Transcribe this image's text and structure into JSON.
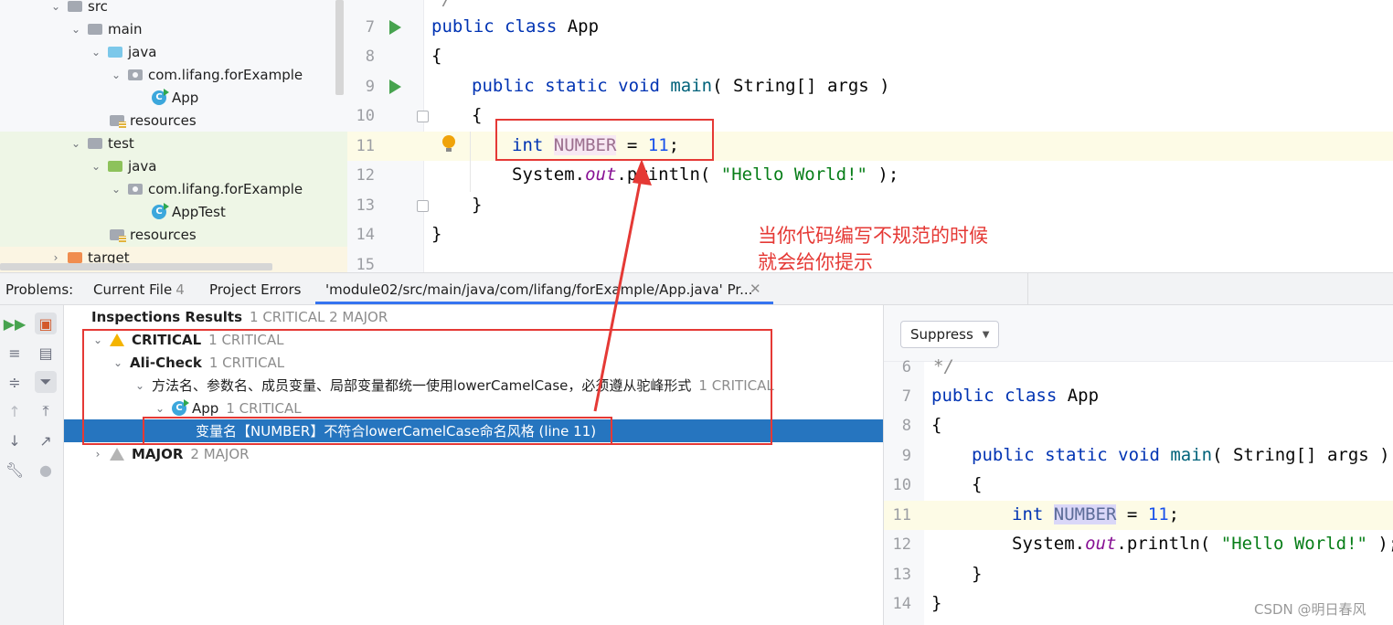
{
  "project_tree": {
    "items": [
      {
        "label": "src"
      },
      {
        "label": "main"
      },
      {
        "label": "java"
      },
      {
        "label": "com.lifang.forExample"
      },
      {
        "label": "App"
      },
      {
        "label": "resources"
      },
      {
        "label": "test"
      },
      {
        "label": "java"
      },
      {
        "label": "com.lifang.forExample"
      },
      {
        "label": "AppTest"
      },
      {
        "label": "resources"
      },
      {
        "label": "target"
      }
    ]
  },
  "editor": {
    "line_numbers": [
      "7",
      "8",
      "9",
      "10",
      "11",
      "12",
      "13",
      "14",
      "15"
    ],
    "partial_top": "*/",
    "tokens": {
      "public_class": "public class ",
      "App": "App",
      "brace_open": "{",
      "public_static_void": "public static void ",
      "main": "main",
      "main_args": "( String[] args )",
      "int_kw": "int",
      "NUMBER": "NUMBER",
      "assign": " = ",
      "eleven": "11",
      "semi": ";",
      "system": "System.",
      "out": "out",
      "println": ".println( ",
      "hello": "\"Hello World!\"",
      "println_end": " );",
      "brace_close": "}"
    }
  },
  "annotation": {
    "line1": "当你代码编写不规范的时候",
    "line2": "就会给你提示",
    "color": "#e53935"
  },
  "problems": {
    "label": "Problems:",
    "tabs": [
      {
        "label": "Current File",
        "count": "4"
      },
      {
        "label": "Project Errors",
        "count": ""
      },
      {
        "label": "'module02/src/main/java/com/lifang/forExample/App.java' Pr...",
        "count": ""
      }
    ],
    "tree": {
      "root": {
        "label": "Inspections Results",
        "count": "1 CRITICAL 2 MAJOR"
      },
      "critical": {
        "label": "CRITICAL",
        "count": "1 CRITICAL"
      },
      "alicheck": {
        "label": "Ali-Check",
        "count": "1 CRITICAL"
      },
      "rule": {
        "label": "方法名、参数名、成员变量、局部变量都统一使用lowerCamelCase，必须遵从驼峰形式",
        "count": "1 CRITICAL"
      },
      "app": {
        "label": "App",
        "count": "1 CRITICAL"
      },
      "problem": {
        "label": "变量名【NUMBER】不符合lowerCamelCase命名风格 (line 11)"
      },
      "major": {
        "label": "MAJOR",
        "count": "2 MAJOR"
      }
    },
    "suppress_label": "Suppress",
    "preview_line_numbers": [
      "6",
      "7",
      "8",
      "9",
      "10",
      "11",
      "12",
      "13",
      "14"
    ]
  },
  "watermark": "CSDN @明日春风",
  "colors": {
    "selection": "#2675bf",
    "annotation_red": "#e53935",
    "keyword": "#0033b3",
    "string": "#067d17",
    "warning": "#f4b400"
  }
}
